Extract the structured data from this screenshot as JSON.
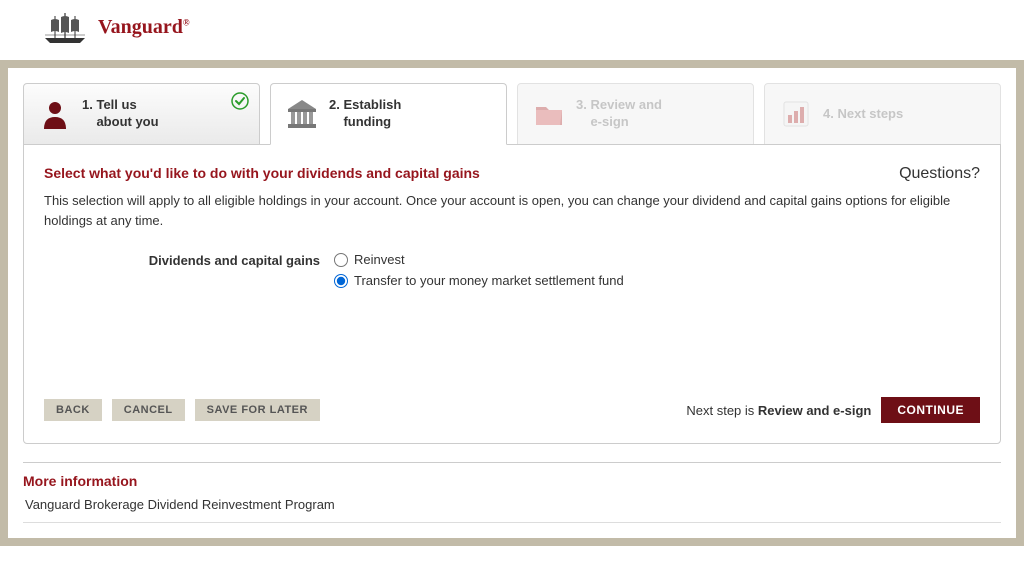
{
  "brand": {
    "name": "Vanguard"
  },
  "steps": [
    {
      "num": "1.",
      "line1": "Tell us",
      "line2": "about you"
    },
    {
      "num": "2.",
      "line1": "Establish",
      "line2": "funding"
    },
    {
      "num": "3.",
      "line1": "Review and",
      "line2": "e-sign"
    },
    {
      "num": "4.",
      "line1": "Next steps",
      "line2": ""
    }
  ],
  "form": {
    "title": "Select what you'd like to do with your dividends and capital gains",
    "questions": "Questions?",
    "desc": "This selection will apply to all eligible holdings in your account. Once your account is open, you can change your dividend and capital gains options for eligible holdings at any time.",
    "field_label": "Dividends and capital gains",
    "radios": {
      "reinvest": "Reinvest",
      "transfer": "Transfer to your money market settlement fund"
    },
    "selected": "transfer"
  },
  "buttons": {
    "back": "BACK",
    "cancel": "CANCEL",
    "save": "SAVE FOR LATER",
    "continue": "CONTINUE"
  },
  "next_step": {
    "prefix": "Next step is ",
    "name": "Review and e-sign"
  },
  "more_info": {
    "title": "More information",
    "link": "Vanguard Brokerage Dividend Reinvestment Program"
  }
}
